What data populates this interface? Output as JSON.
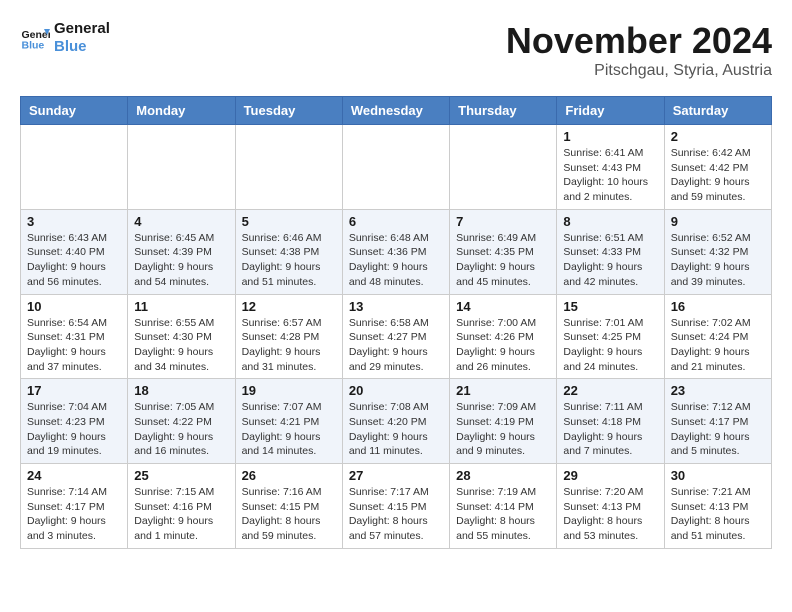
{
  "header": {
    "logo_line1": "General",
    "logo_line2": "Blue",
    "month_year": "November 2024",
    "location": "Pitschgau, Styria, Austria"
  },
  "weekdays": [
    "Sunday",
    "Monday",
    "Tuesday",
    "Wednesday",
    "Thursday",
    "Friday",
    "Saturday"
  ],
  "weeks": [
    [
      {
        "day": "",
        "info": ""
      },
      {
        "day": "",
        "info": ""
      },
      {
        "day": "",
        "info": ""
      },
      {
        "day": "",
        "info": ""
      },
      {
        "day": "",
        "info": ""
      },
      {
        "day": "1",
        "info": "Sunrise: 6:41 AM\nSunset: 4:43 PM\nDaylight: 10 hours\nand 2 minutes."
      },
      {
        "day": "2",
        "info": "Sunrise: 6:42 AM\nSunset: 4:42 PM\nDaylight: 9 hours\nand 59 minutes."
      }
    ],
    [
      {
        "day": "3",
        "info": "Sunrise: 6:43 AM\nSunset: 4:40 PM\nDaylight: 9 hours\nand 56 minutes."
      },
      {
        "day": "4",
        "info": "Sunrise: 6:45 AM\nSunset: 4:39 PM\nDaylight: 9 hours\nand 54 minutes."
      },
      {
        "day": "5",
        "info": "Sunrise: 6:46 AM\nSunset: 4:38 PM\nDaylight: 9 hours\nand 51 minutes."
      },
      {
        "day": "6",
        "info": "Sunrise: 6:48 AM\nSunset: 4:36 PM\nDaylight: 9 hours\nand 48 minutes."
      },
      {
        "day": "7",
        "info": "Sunrise: 6:49 AM\nSunset: 4:35 PM\nDaylight: 9 hours\nand 45 minutes."
      },
      {
        "day": "8",
        "info": "Sunrise: 6:51 AM\nSunset: 4:33 PM\nDaylight: 9 hours\nand 42 minutes."
      },
      {
        "day": "9",
        "info": "Sunrise: 6:52 AM\nSunset: 4:32 PM\nDaylight: 9 hours\nand 39 minutes."
      }
    ],
    [
      {
        "day": "10",
        "info": "Sunrise: 6:54 AM\nSunset: 4:31 PM\nDaylight: 9 hours\nand 37 minutes."
      },
      {
        "day": "11",
        "info": "Sunrise: 6:55 AM\nSunset: 4:30 PM\nDaylight: 9 hours\nand 34 minutes."
      },
      {
        "day": "12",
        "info": "Sunrise: 6:57 AM\nSunset: 4:28 PM\nDaylight: 9 hours\nand 31 minutes."
      },
      {
        "day": "13",
        "info": "Sunrise: 6:58 AM\nSunset: 4:27 PM\nDaylight: 9 hours\nand 29 minutes."
      },
      {
        "day": "14",
        "info": "Sunrise: 7:00 AM\nSunset: 4:26 PM\nDaylight: 9 hours\nand 26 minutes."
      },
      {
        "day": "15",
        "info": "Sunrise: 7:01 AM\nSunset: 4:25 PM\nDaylight: 9 hours\nand 24 minutes."
      },
      {
        "day": "16",
        "info": "Sunrise: 7:02 AM\nSunset: 4:24 PM\nDaylight: 9 hours\nand 21 minutes."
      }
    ],
    [
      {
        "day": "17",
        "info": "Sunrise: 7:04 AM\nSunset: 4:23 PM\nDaylight: 9 hours\nand 19 minutes."
      },
      {
        "day": "18",
        "info": "Sunrise: 7:05 AM\nSunset: 4:22 PM\nDaylight: 9 hours\nand 16 minutes."
      },
      {
        "day": "19",
        "info": "Sunrise: 7:07 AM\nSunset: 4:21 PM\nDaylight: 9 hours\nand 14 minutes."
      },
      {
        "day": "20",
        "info": "Sunrise: 7:08 AM\nSunset: 4:20 PM\nDaylight: 9 hours\nand 11 minutes."
      },
      {
        "day": "21",
        "info": "Sunrise: 7:09 AM\nSunset: 4:19 PM\nDaylight: 9 hours\nand 9 minutes."
      },
      {
        "day": "22",
        "info": "Sunrise: 7:11 AM\nSunset: 4:18 PM\nDaylight: 9 hours\nand 7 minutes."
      },
      {
        "day": "23",
        "info": "Sunrise: 7:12 AM\nSunset: 4:17 PM\nDaylight: 9 hours\nand 5 minutes."
      }
    ],
    [
      {
        "day": "24",
        "info": "Sunrise: 7:14 AM\nSunset: 4:17 PM\nDaylight: 9 hours\nand 3 minutes."
      },
      {
        "day": "25",
        "info": "Sunrise: 7:15 AM\nSunset: 4:16 PM\nDaylight: 9 hours\nand 1 minute."
      },
      {
        "day": "26",
        "info": "Sunrise: 7:16 AM\nSunset: 4:15 PM\nDaylight: 8 hours\nand 59 minutes."
      },
      {
        "day": "27",
        "info": "Sunrise: 7:17 AM\nSunset: 4:15 PM\nDaylight: 8 hours\nand 57 minutes."
      },
      {
        "day": "28",
        "info": "Sunrise: 7:19 AM\nSunset: 4:14 PM\nDaylight: 8 hours\nand 55 minutes."
      },
      {
        "day": "29",
        "info": "Sunrise: 7:20 AM\nSunset: 4:13 PM\nDaylight: 8 hours\nand 53 minutes."
      },
      {
        "day": "30",
        "info": "Sunrise: 7:21 AM\nSunset: 4:13 PM\nDaylight: 8 hours\nand 51 minutes."
      }
    ]
  ]
}
